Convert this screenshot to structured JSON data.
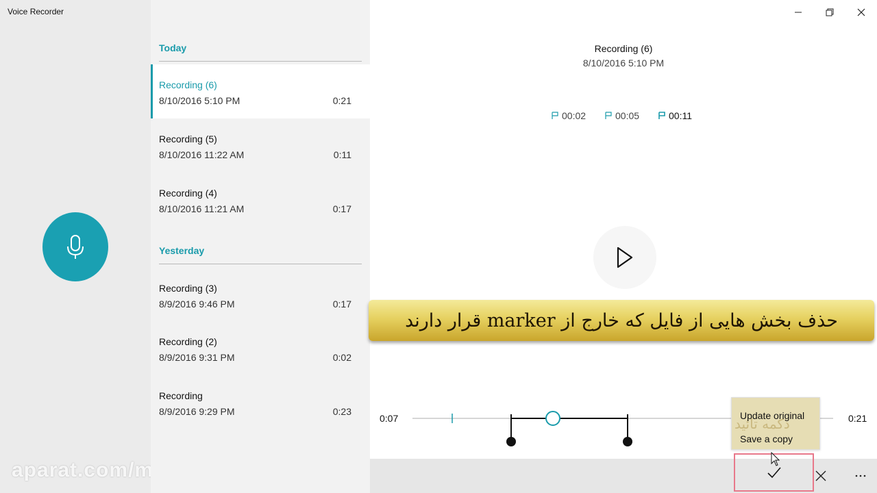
{
  "window": {
    "title": "Voice Recorder"
  },
  "groups": [
    {
      "label": "Today"
    },
    {
      "label": "Yesterday"
    }
  ],
  "recordings": [
    {
      "name": "Recording (6)",
      "date": "8/10/2016 5:10 PM",
      "duration": "0:21",
      "selected": true
    },
    {
      "name": "Recording (5)",
      "date": "8/10/2016 11:22 AM",
      "duration": "0:11"
    },
    {
      "name": "Recording (4)",
      "date": "8/10/2016 11:21 AM",
      "duration": "0:17"
    },
    {
      "name": "Recording (3)",
      "date": "8/9/2016 9:46 PM",
      "duration": "0:17"
    },
    {
      "name": "Recording (2)",
      "date": "8/9/2016 9:31 PM",
      "duration": "0:02"
    },
    {
      "name": "Recording",
      "date": "8/9/2016 9:29 PM",
      "duration": "0:23"
    }
  ],
  "detail": {
    "title": "Recording (6)",
    "date": "8/10/2016 5:10 PM",
    "markers": [
      "00:02",
      "00:05",
      "00:11"
    ],
    "trim": {
      "start_label": "0:07",
      "end_label": "0:21"
    }
  },
  "banner": {
    "text": "حذف بخش هایی از فایل که خارج از marker قرار دارند"
  },
  "save_menu": {
    "update_label": "Update original",
    "copy_label": "Save a copy",
    "overlay_text": "دکمه تائید"
  },
  "watermark": {
    "text": "aparat.com/mrk.it"
  },
  "colors": {
    "accent": "#1a9bab",
    "mic": "#1aa0b2",
    "banner": "#e6d160"
  }
}
